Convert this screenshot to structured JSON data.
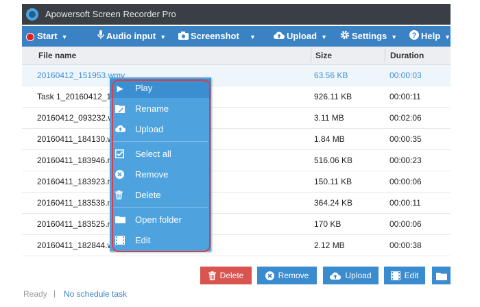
{
  "window": {
    "title": "Apowersoft Screen Recorder Pro"
  },
  "toolbar": {
    "start": "Start",
    "audio_input": "Audio input",
    "screenshot": "Screenshot",
    "upload": "Upload",
    "settings": "Settings",
    "help": "Help"
  },
  "table": {
    "columns": {
      "file_name": "File name",
      "size": "Size",
      "duration": "Duration"
    },
    "rows": [
      {
        "name": "20160412_151953.wmv",
        "size": "63.56 KB",
        "duration": "00:00:03"
      },
      {
        "name": "Task 1_20160412_143",
        "size": "926.11 KB",
        "duration": "00:00:11"
      },
      {
        "name": "20160412_093232.wm",
        "size": "3.11 MB",
        "duration": "00:02:06"
      },
      {
        "name": "20160411_184130.wm",
        "size": "1.84 MB",
        "duration": "00:00:35"
      },
      {
        "name": "20160411_183946.mp",
        "size": "516.06 KB",
        "duration": "00:00:23"
      },
      {
        "name": "20160411_183923.mp",
        "size": "150.11 KB",
        "duration": "00:00:06"
      },
      {
        "name": "20160411_183538.mp",
        "size": "364.24 KB",
        "duration": "00:00:11"
      },
      {
        "name": "20160411_183525.mp",
        "size": "170 KB",
        "duration": "00:00:06"
      },
      {
        "name": "20160411_182844.wmv",
        "size": "2.12 MB",
        "duration": "00:00:38"
      }
    ]
  },
  "context_menu": {
    "play": "Play",
    "rename": "Rename",
    "upload": "Upload",
    "select_all": "Select all",
    "remove": "Remove",
    "delete": "Delete",
    "open_folder": "Open folder",
    "edit": "Edit"
  },
  "actions": {
    "delete": "Delete",
    "remove": "Remove",
    "upload": "Upload",
    "edit": "Edit"
  },
  "status": {
    "ready": "Ready",
    "separator": "|",
    "schedule": "No schedule task"
  },
  "colors": {
    "titlebar": "#3a3f45",
    "toolbar": "#3b82c4",
    "menu": "#4ea3de",
    "highlight_outline": "#d6404a",
    "delete_button": "#d9534f"
  }
}
